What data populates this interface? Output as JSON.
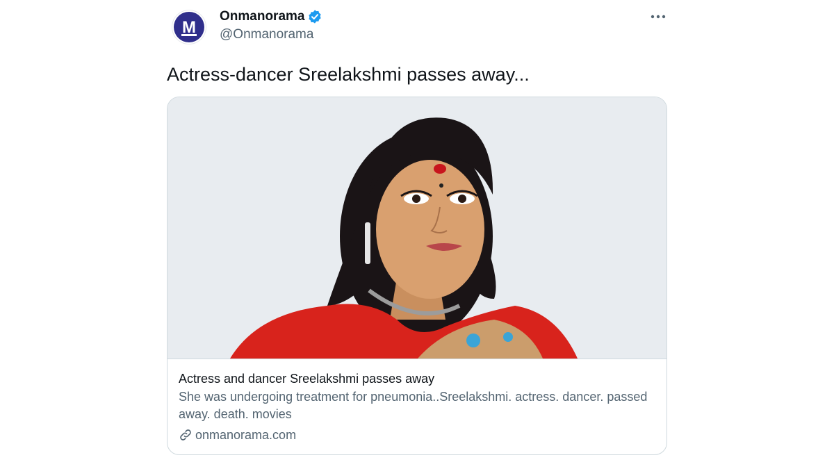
{
  "author": {
    "name": "Onmanorama",
    "handle": "@Onmanorama",
    "avatar_letter": "M",
    "verified": true
  },
  "tweet": {
    "text": "Actress-dancer Sreelakshmi passes away..."
  },
  "card": {
    "title": "Actress and dancer Sreelakshmi passes away",
    "description": "She was undergoing treatment for pneumonia..Sreelakshmi. actress. dancer. passed away. death. movies",
    "domain": "onmanorama.com"
  },
  "icons": {
    "verified": "verified-badge-icon",
    "more": "more-options-icon",
    "link": "link-icon"
  },
  "colors": {
    "brand_avatar": "#2f2e8b",
    "verified_blue": "#1d9bf0",
    "text_primary": "#0f1419",
    "text_secondary": "#536471",
    "card_border": "#cfd9de"
  }
}
